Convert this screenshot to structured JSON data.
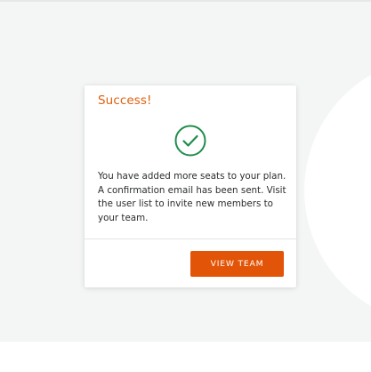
{
  "modal": {
    "title": "Success!",
    "icon": "check-circle-icon",
    "message": "You have added more seats to your plan. A confirmation email has been sent. Visit the user list to invite new members to your team.",
    "button_label": "VIEW TEAM"
  },
  "colors": {
    "title": "#e0600e",
    "check": "#1f8d4c",
    "button": "#e25508",
    "backdrop": "#f4f5f5"
  }
}
